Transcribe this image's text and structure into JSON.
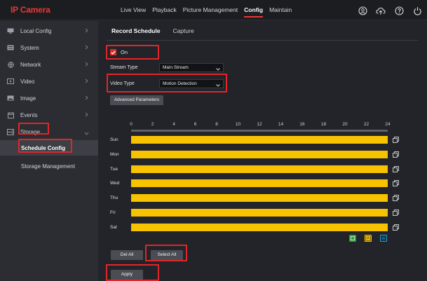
{
  "app": {
    "title": "IP Camera"
  },
  "nav": [
    "Live View",
    "Playback",
    "Picture Management",
    "Config",
    "Maintain"
  ],
  "top_icons": [
    "user-icon",
    "cloud-icon",
    "help-icon",
    "power-icon"
  ],
  "sidebar": {
    "items": [
      {
        "label": "Local Config",
        "icon": "monitor-icon"
      },
      {
        "label": "System",
        "icon": "system-icon"
      },
      {
        "label": "Network",
        "icon": "network-icon"
      },
      {
        "label": "Video",
        "icon": "video-icon"
      },
      {
        "label": "Image",
        "icon": "image-icon"
      },
      {
        "label": "Events",
        "icon": "events-icon"
      },
      {
        "label": "Storage",
        "icon": "storage-icon"
      }
    ],
    "sub_items": [
      "Schedule Config",
      "Storage Management"
    ]
  },
  "tabs": [
    "Record Schedule",
    "Capture"
  ],
  "form": {
    "enable_label": "On",
    "enabled": true,
    "stream_type_label": "Stream Type",
    "stream_type_value": "Main Stream",
    "video_type_label": "Video Type",
    "video_type_value": "Motion Detection",
    "advanced_label": "Advanced Parameters"
  },
  "schedule": {
    "hours": [
      "0",
      "2",
      "4",
      "6",
      "8",
      "10",
      "12",
      "14",
      "16",
      "18",
      "20",
      "22",
      "24"
    ],
    "days": [
      "Sun",
      "Mon",
      "Tue",
      "Wed",
      "Thu",
      "Fri",
      "Sat"
    ],
    "bar_color": "#f7c300",
    "legend": [
      {
        "label": "T",
        "color": "#2e9e3e"
      },
      {
        "label": "M",
        "color": "#f7c300"
      },
      {
        "label": "AI",
        "color": "#1aa3d9"
      }
    ]
  },
  "buttons": {
    "del_all": "Del All",
    "select_all": "Select All",
    "apply": "Apply"
  },
  "colors": {
    "accent": "#e53935",
    "highlight": "#e0262b"
  }
}
